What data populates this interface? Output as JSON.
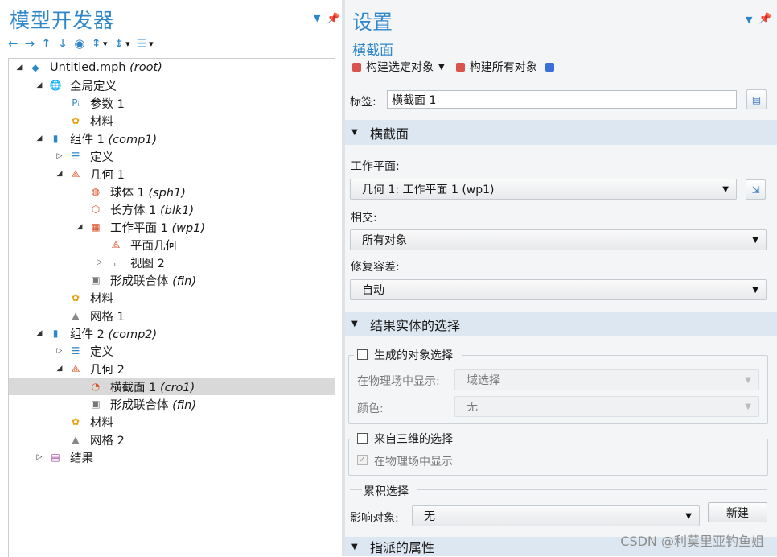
{
  "left_panel": {
    "title": "模型开发器",
    "toolbar": [
      "←",
      "→",
      "↑",
      "↓",
      "◉",
      "⇞",
      "▾",
      "⇟",
      "▾",
      "☰",
      "▾"
    ]
  },
  "tree": [
    {
      "label": "Untitled.mph",
      "tag": "(root)",
      "exp": "◢",
      "icon": "model-icon",
      "lvl": 0
    },
    {
      "label": "全局定义",
      "tag": "",
      "exp": "◢",
      "icon": "globe-icon",
      "lvl": 1
    },
    {
      "label": "参数 1",
      "tag": "",
      "exp": "",
      "icon": "parameter-icon",
      "lvl": 2
    },
    {
      "label": "材料",
      "tag": "",
      "exp": "",
      "icon": "material-icon",
      "lvl": 2
    },
    {
      "label": "组件 1",
      "tag": "(comp1)",
      "exp": "◢",
      "icon": "component-icon",
      "lvl": 1
    },
    {
      "label": "定义",
      "tag": "",
      "exp": "▷",
      "icon": "definitions-icon",
      "lvl": 2
    },
    {
      "label": "几何 1",
      "tag": "",
      "exp": "◢",
      "icon": "geometry-icon",
      "lvl": 2
    },
    {
      "label": "球体 1",
      "tag": "(sph1)",
      "exp": "",
      "icon": "sphere-icon",
      "lvl": 3
    },
    {
      "label": "长方体 1",
      "tag": "(blk1)",
      "exp": "",
      "icon": "block-icon",
      "lvl": 3
    },
    {
      "label": "工作平面 1",
      "tag": "(wp1)",
      "exp": "◢",
      "icon": "workplane-icon",
      "lvl": 3
    },
    {
      "label": "平面几何",
      "tag": "",
      "exp": "",
      "icon": "plane-geometry-icon",
      "lvl": 4
    },
    {
      "label": "视图 2",
      "tag": "",
      "exp": "▷",
      "icon": "view-icon",
      "lvl": 4
    },
    {
      "label": "形成联合体",
      "tag": "(fin)",
      "exp": "",
      "icon": "form-union-icon",
      "lvl": 3
    },
    {
      "label": "材料",
      "tag": "",
      "exp": "",
      "icon": "material-icon",
      "lvl": 2
    },
    {
      "label": "网格 1",
      "tag": "",
      "exp": "",
      "icon": "mesh-icon",
      "lvl": 2
    },
    {
      "label": "组件 2",
      "tag": "(comp2)",
      "exp": "◢",
      "icon": "component-icon",
      "lvl": 1
    },
    {
      "label": "定义",
      "tag": "",
      "exp": "▷",
      "icon": "definitions-icon",
      "lvl": 2
    },
    {
      "label": "几何 2",
      "tag": "",
      "exp": "◢",
      "icon": "geometry-icon",
      "lvl": 2
    },
    {
      "label": "横截面 1",
      "tag": "(cro1)",
      "exp": "",
      "icon": "cross-section-icon",
      "lvl": 3,
      "selected": true
    },
    {
      "label": "形成联合体",
      "tag": "(fin)",
      "exp": "",
      "icon": "form-union-icon",
      "lvl": 3
    },
    {
      "label": "材料",
      "tag": "",
      "exp": "",
      "icon": "material-icon",
      "lvl": 2
    },
    {
      "label": "网格 2",
      "tag": "",
      "exp": "",
      "icon": "mesh-icon",
      "lvl": 2
    },
    {
      "label": "结果",
      "tag": "",
      "exp": "▷",
      "icon": "results-icon",
      "lvl": 1
    }
  ],
  "settings": {
    "title": "设置",
    "subtitle": "横截面",
    "build_selected": "构建选定对象",
    "build_all": "构建所有对象",
    "label_caption": "标签:",
    "label_value": "横截面 1",
    "section1": "横截面",
    "workplane_caption": "工作平面:",
    "workplane_value": "几何 1: 工作平面 1 (wp1)",
    "intersect_caption": "相交:",
    "intersect_value": "所有对象",
    "repair_caption": "修复容差:",
    "repair_value": "自动",
    "section2": "结果实体的选择",
    "generated_selection": "生成的对象选择",
    "show_in_physics_caption": "在物理场中显示:",
    "show_in_physics_value": "域选择",
    "color_caption": "颜色:",
    "color_value": "无",
    "from_3d_selection": "来自三维的选择",
    "show_in_physics_check": "在物理场中显示",
    "cumulative_header": "累积选择",
    "contribute_caption": "影响对象:",
    "contribute_value": "无",
    "new_button": "新建",
    "section3": "指派的属性"
  },
  "watermark": "CSDN @利莫里亚钓鱼姐",
  "colors": {
    "accent": "#2f86c8",
    "section_bg": "#dde7f1",
    "selected_row": "#d9d9d9"
  }
}
